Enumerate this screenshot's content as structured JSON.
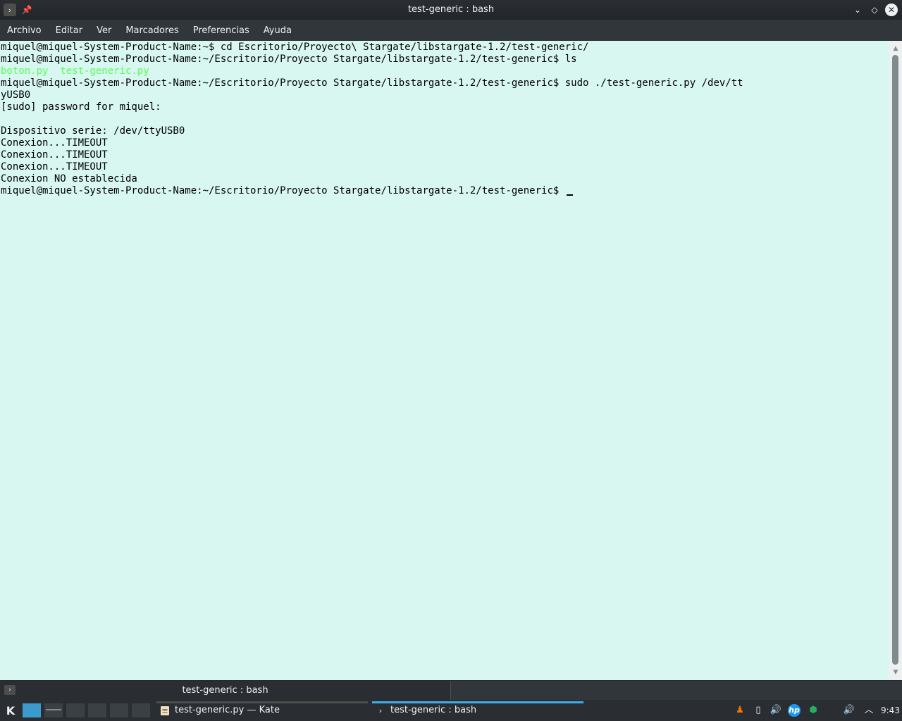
{
  "window": {
    "title": "test-generic : bash",
    "app_icon": "terminal-icon",
    "pin_icon": "pin-icon",
    "minimize_glyph": "⌄",
    "maximize_glyph": "◇",
    "close_glyph": "✕"
  },
  "menubar": {
    "items": [
      "Archivo",
      "Editar",
      "Ver",
      "Marcadores",
      "Preferencias",
      "Ayuda"
    ]
  },
  "terminal": {
    "background": "#d8f7f0",
    "ls_color": "#54ff54",
    "lines": [
      "miquel@miquel-System-Product-Name:~$ cd Escritorio/Proyecto\\ Stargate/libstargate-1.2/test-generic/",
      "miquel@miquel-System-Product-Name:~/Escritorio/Proyecto Stargate/libstargate-1.2/test-generic$ ls",
      "",
      "miquel@miquel-System-Product-Name:~/Escritorio/Proyecto Stargate/libstargate-1.2/test-generic$ sudo ./test-generic.py /dev/tt",
      "yUSB0",
      "[sudo] password for miquel:",
      "",
      "Dispositivo serie: /dev/ttyUSB0",
      "Conexion...TIMEOUT",
      "Conexion...TIMEOUT",
      "Conexion...TIMEOUT",
      "Conexion NO establecida",
      "miquel@miquel-System-Product-Name:~/Escritorio/Proyecto Stargate/libstargate-1.2/test-generic$ "
    ],
    "ls_output": "boton.py  test-generic.py"
  },
  "tabbar": {
    "tab_label": "test-generic : bash"
  },
  "taskbar": {
    "launcher_glyph": "K",
    "tasks": [
      {
        "label": "test-generic.py — Kate",
        "icon": "kate-icon"
      },
      {
        "label": "test-generic : bash",
        "icon": "terminal-icon"
      }
    ],
    "clock": "9:43"
  }
}
